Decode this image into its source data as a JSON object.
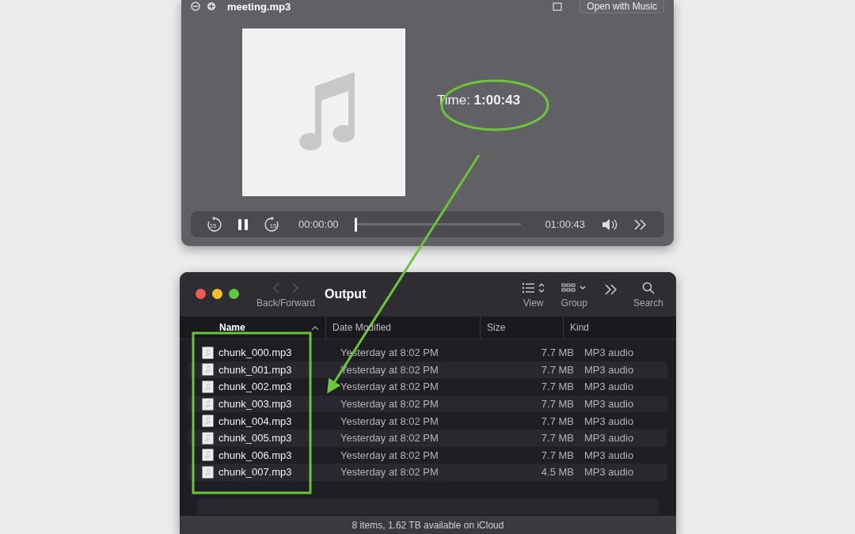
{
  "player": {
    "title": "meeting.mp3",
    "open_button": "Open with Music",
    "time_text": "Time: **1:00:43**",
    "controls": {
      "back_label": "15",
      "forward_label": "15",
      "playing": true,
      "elapsed": "00:00:00",
      "level": 0,
      "duration": "01:00:43"
    }
  },
  "finder": {
    "title": "Output",
    "nav_label": "Back/Forward",
    "view_label": "View",
    "group_label": "Group",
    "search_label": "Search",
    "columns": [
      {
        "label": "Name",
        "sorted": true
      },
      {
        "label": "Date Modified",
        "sorted": false
      },
      {
        "label": "Size",
        "sorted": false
      },
      {
        "label": "Kind",
        "sorted": false
      }
    ],
    "rows": [
      {
        "name": "chunk_000.mp3",
        "date": "Yesterday at 8:02 PM",
        "size": "7.7 MB",
        "kind": "MP3 audio"
      },
      {
        "name": "chunk_001.mp3",
        "date": "Yesterday at 8:02 PM",
        "size": "7.7 MB",
        "kind": "MP3 audio"
      },
      {
        "name": "chunk_002.mp3",
        "date": "Yesterday at 8:02 PM",
        "size": "7.7 MB",
        "kind": "MP3 audio"
      },
      {
        "name": "chunk_003.mp3",
        "date": "Yesterday at 8:02 PM",
        "size": "7.7 MB",
        "kind": "MP3 audio"
      },
      {
        "name": "chunk_004.mp3",
        "date": "Yesterday at 8:02 PM",
        "size": "7.7 MB",
        "kind": "MP3 audio"
      },
      {
        "name": "chunk_005.mp3",
        "date": "Yesterday at 8:02 PM",
        "size": "7.7 MB",
        "kind": "MP3 audio"
      },
      {
        "name": "chunk_006.mp3",
        "date": "Yesterday at 8:02 PM",
        "size": "7.7 MB",
        "kind": "MP3 audio"
      },
      {
        "name": "chunk_007.mp3",
        "date": "Yesterday at 8:02 PM",
        "size": "4.5 MB",
        "kind": "MP3 audio"
      }
    ],
    "status": "8 items, 1.62 TB available on iCloud"
  },
  "annotations": [
    {
      "kind": "ellipse"
    },
    {
      "kind": "arrow"
    },
    {
      "kind": "rectangle"
    }
  ]
}
